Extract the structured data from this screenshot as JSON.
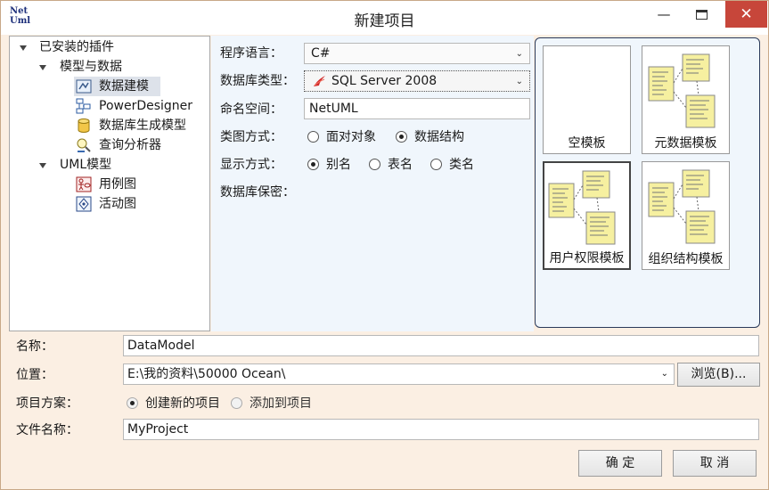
{
  "window": {
    "title": "新建项目",
    "logo_text_1": "Net",
    "logo_text_2": "Uml"
  },
  "title_buttons": {
    "minimize": "—",
    "close": "✕"
  },
  "tree": {
    "root": "已安装的插件",
    "group1": "模型与数据",
    "group1_items": [
      "数据建模",
      "PowerDesigner",
      "数据库生成模型",
      "查询分析器"
    ],
    "group2": "UML模型",
    "group2_items": [
      "用例图",
      "活动图"
    ]
  },
  "form": {
    "lang_label": "程序语言：",
    "lang_value": "C#",
    "dbtype_label": "数据库类型：",
    "dbtype_value": "SQL Server 2008",
    "namespace_label": "命名空间：",
    "namespace_value": "NetUML",
    "diagram_label": "类图方式：",
    "diagram_opt1": "面对对象",
    "diagram_opt2": "数据结构",
    "diagram_selected": "数据结构",
    "display_label": "显示方式：",
    "display_opt1": "别名",
    "display_opt2": "表名",
    "display_opt3": "类名",
    "display_selected": "别名",
    "secret_label": "数据库保密："
  },
  "templates": [
    "空模板",
    "元数据模板",
    "用户权限模板",
    "组织结构模板"
  ],
  "bottom": {
    "name_label": "名称：",
    "name_value": "DataModel",
    "location_label": "位置：",
    "location_value": "E:\\我的资料\\50000  Ocean\\",
    "browse_label": "浏览(B)...",
    "solution_label": "项目方案：",
    "solution_opt1": "创建新的项目",
    "solution_opt2": "添加到项目",
    "filename_label": "文件名称：",
    "filename_value": "MyProject",
    "ok_label": "确 定",
    "cancel_label": "取 消"
  },
  "colors": {
    "footer_bg": "#fbefe3",
    "form_bg": "#f0f6fc",
    "close_red": "#c7463a",
    "note_yellow": "#f6f0a0"
  }
}
